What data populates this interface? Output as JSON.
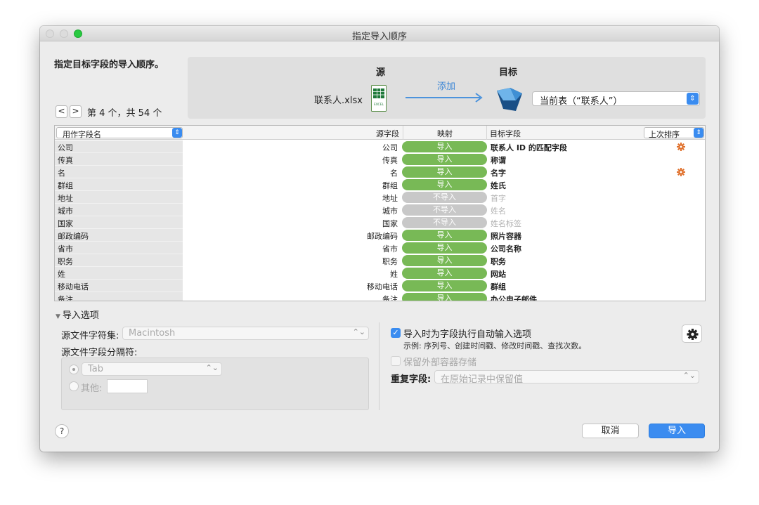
{
  "window": {
    "title": "指定导入顺序"
  },
  "header": {
    "instruction": "指定目标字段的导入顺序。",
    "nav_prev": "<",
    "nav_next": ">",
    "record_position": "第 4 个，共 54 个"
  },
  "mapping": {
    "source_heading": "源",
    "target_heading": "目标",
    "source_file": "联系人.xlsx",
    "excel_icon_label": "EXCEL",
    "action_label": "添加",
    "target_table": "当前表（“联系人”）"
  },
  "grid": {
    "name_column_select": "用作字段名",
    "col_source": "源字段",
    "col_mapping": "映射",
    "col_target": "目标字段",
    "sort_select": "上次排序",
    "rows": [
      {
        "name": "公司",
        "source": "公司",
        "mapping": "导入",
        "target": "联系人 ID 的匹配字段",
        "gear": true
      },
      {
        "name": "传真",
        "source": "传真",
        "mapping": "导入",
        "target": "称谓",
        "gear": false
      },
      {
        "name": "名",
        "source": "名",
        "mapping": "导入",
        "target": "名字",
        "gear": true
      },
      {
        "name": "群组",
        "source": "群组",
        "mapping": "导入",
        "target": "姓氏",
        "gear": false
      },
      {
        "name": "地址",
        "source": "地址",
        "mapping": "不导入",
        "target": "首字",
        "gear": false
      },
      {
        "name": "城市",
        "source": "城市",
        "mapping": "不导入",
        "target": "姓名",
        "gear": false
      },
      {
        "name": "国家",
        "source": "国家",
        "mapping": "不导入",
        "target": "姓名标签",
        "gear": false
      },
      {
        "name": "邮政编码",
        "source": "邮政编码",
        "mapping": "导入",
        "target": "照片容器",
        "gear": false
      },
      {
        "name": "省市",
        "source": "省市",
        "mapping": "导入",
        "target": "公司名称",
        "gear": false
      },
      {
        "name": "职务",
        "source": "职务",
        "mapping": "导入",
        "target": "职务",
        "gear": false
      },
      {
        "name": "姓",
        "source": "姓",
        "mapping": "导入",
        "target": "网站",
        "gear": false
      },
      {
        "name": "移动电话",
        "source": "移动电话",
        "mapping": "导入",
        "target": "群组",
        "gear": false
      },
      {
        "name": "备注",
        "source": "备注",
        "mapping": "导入",
        "target": "办公电子邮件",
        "gear": false
      }
    ]
  },
  "options": {
    "toggle_label": "导入选项",
    "charset_label": "源文件字符集:",
    "charset_value": "Macintosh",
    "delimiter_label": "源文件字段分隔符:",
    "delimiter_tab": "Tab",
    "delimiter_other_label": "其他:",
    "delimiter_other_value": "",
    "auto_enter_label": "导入时为字段执行自动输入选项",
    "auto_enter_checked": true,
    "auto_enter_example": "示例: 序列号、创建时间戳、修改时间戳、查找次数。",
    "external_storage_label": "保留外部容器存储",
    "external_storage_checked": false,
    "duplicate_label": "重复字段:",
    "duplicate_value": "在原始记录中保留值"
  },
  "footer": {
    "help": "?",
    "cancel": "取消",
    "import": "导入"
  },
  "colors": {
    "accent": "#3a8cf0",
    "import_pill": "#78b956",
    "skip_pill": "#c8c8c8",
    "gear": "#e0702b"
  }
}
